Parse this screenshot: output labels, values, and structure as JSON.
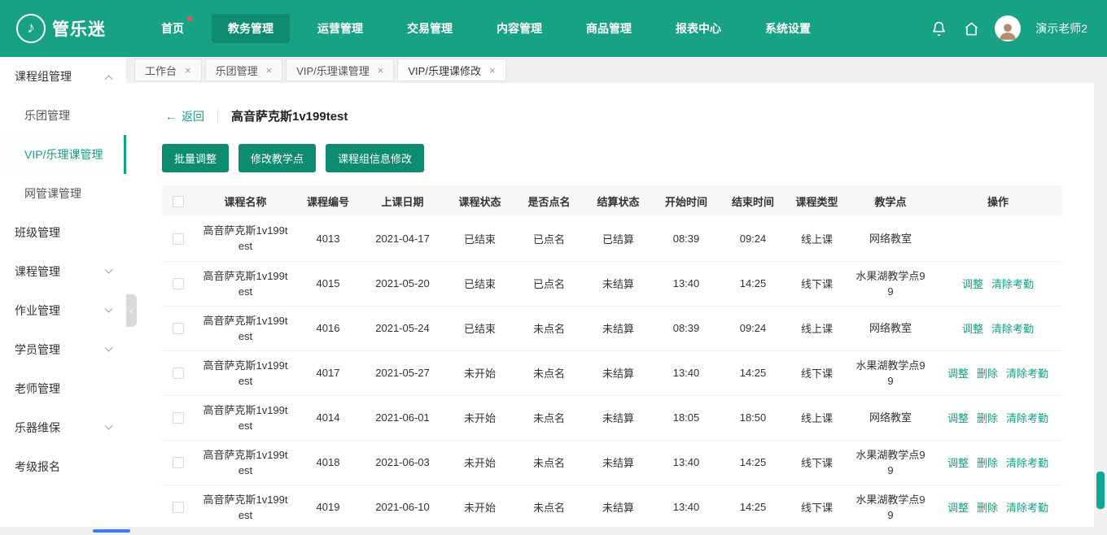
{
  "header": {
    "brand": "管乐迷",
    "logo_glyph": "♪",
    "nav": [
      {
        "label": "首页",
        "active": false,
        "badge": true
      },
      {
        "label": "教务管理",
        "active": true,
        "badge": false
      },
      {
        "label": "运营管理",
        "active": false,
        "badge": false
      },
      {
        "label": "交易管理",
        "active": false,
        "badge": false
      },
      {
        "label": "内容管理",
        "active": false,
        "badge": false
      },
      {
        "label": "商品管理",
        "active": false,
        "badge": false
      },
      {
        "label": "报表中心",
        "active": false,
        "badge": false
      },
      {
        "label": "系统设置",
        "active": false,
        "badge": false
      }
    ],
    "user": "演示老师2"
  },
  "sidebar": {
    "items": [
      {
        "label": "课程组管理",
        "type": "group",
        "chevron": "up"
      },
      {
        "label": "乐团管理",
        "type": "sub",
        "active": false
      },
      {
        "label": "VIP/乐理课管理",
        "type": "sub",
        "active": true
      },
      {
        "label": "网管课管理",
        "type": "sub",
        "active": false
      },
      {
        "label": "班级管理",
        "type": "item"
      },
      {
        "label": "课程管理",
        "type": "group",
        "chevron": "down"
      },
      {
        "label": "作业管理",
        "type": "group",
        "chevron": "down"
      },
      {
        "label": "学员管理",
        "type": "group",
        "chevron": "down"
      },
      {
        "label": "老师管理",
        "type": "item"
      },
      {
        "label": "乐器维保",
        "type": "group",
        "chevron": "down"
      },
      {
        "label": "考级报名",
        "type": "item"
      }
    ]
  },
  "tabs": [
    {
      "label": "工作台",
      "active": false
    },
    {
      "label": "乐团管理",
      "active": false
    },
    {
      "label": "VIP/乐理课管理",
      "active": false
    },
    {
      "label": "VIP/乐理课修改",
      "active": true
    }
  ],
  "page": {
    "back_arrow": "←",
    "back": "返回",
    "title": "高音萨克斯1v199test",
    "buttons": [
      "批量调整",
      "修改教学点",
      "课程组信息修改"
    ]
  },
  "table": {
    "columns": [
      "课程名称",
      "课程编号",
      "上课日期",
      "课程状态",
      "是否点名",
      "结算状态",
      "开始时间",
      "结束时间",
      "课程类型",
      "教学点",
      "操作"
    ],
    "rows": [
      {
        "name": "高音萨克斯1v199test",
        "code": "4013",
        "date": "2021-04-17",
        "status": "已结束",
        "rollcall": "已点名",
        "settle": "已结算",
        "start": "08:39",
        "end": "09:24",
        "type": "线上课",
        "location": "网络教室",
        "actions": []
      },
      {
        "name": "高音萨克斯1v199test",
        "code": "4015",
        "date": "2021-05-20",
        "status": "已结束",
        "rollcall": "已点名",
        "settle": "未结算",
        "start": "13:40",
        "end": "14:25",
        "type": "线下课",
        "location": "水果湖教学点99",
        "actions": [
          "调整",
          "清除考勤"
        ]
      },
      {
        "name": "高音萨克斯1v199test",
        "code": "4016",
        "date": "2021-05-24",
        "status": "已结束",
        "rollcall": "未点名",
        "settle": "未结算",
        "start": "08:39",
        "end": "09:24",
        "type": "线上课",
        "location": "网络教室",
        "actions": [
          "调整",
          "清除考勤"
        ]
      },
      {
        "name": "高音萨克斯1v199test",
        "code": "4017",
        "date": "2021-05-27",
        "status": "未开始",
        "rollcall": "未点名",
        "settle": "未结算",
        "start": "13:40",
        "end": "14:25",
        "type": "线下课",
        "location": "水果湖教学点99",
        "actions": [
          "调整",
          "删除",
          "清除考勤"
        ]
      },
      {
        "name": "高音萨克斯1v199test",
        "code": "4014",
        "date": "2021-06-01",
        "status": "未开始",
        "rollcall": "未点名",
        "settle": "未结算",
        "start": "18:05",
        "end": "18:50",
        "type": "线上课",
        "location": "网络教室",
        "actions": [
          "调整",
          "删除",
          "清除考勤"
        ]
      },
      {
        "name": "高音萨克斯1v199test",
        "code": "4018",
        "date": "2021-06-03",
        "status": "未开始",
        "rollcall": "未点名",
        "settle": "未结算",
        "start": "13:40",
        "end": "14:25",
        "type": "线下课",
        "location": "水果湖教学点99",
        "actions": [
          "调整",
          "删除",
          "清除考勤"
        ]
      },
      {
        "name": "高音萨克斯1v199test",
        "code": "4019",
        "date": "2021-06-10",
        "status": "未开始",
        "rollcall": "未点名",
        "settle": "未结算",
        "start": "13:40",
        "end": "14:25",
        "type": "线下课",
        "location": "水果湖教学点99",
        "actions": [
          "调整",
          "删除",
          "清除考勤"
        ]
      }
    ]
  },
  "colors": {
    "header_bg": "#17a286",
    "active_pill": "#0e8c6f",
    "link": "#12a182",
    "badge": "#ff4d4f",
    "vscroll_thumb": "#12a596",
    "hscroll_thumb": "#3a7afe"
  }
}
